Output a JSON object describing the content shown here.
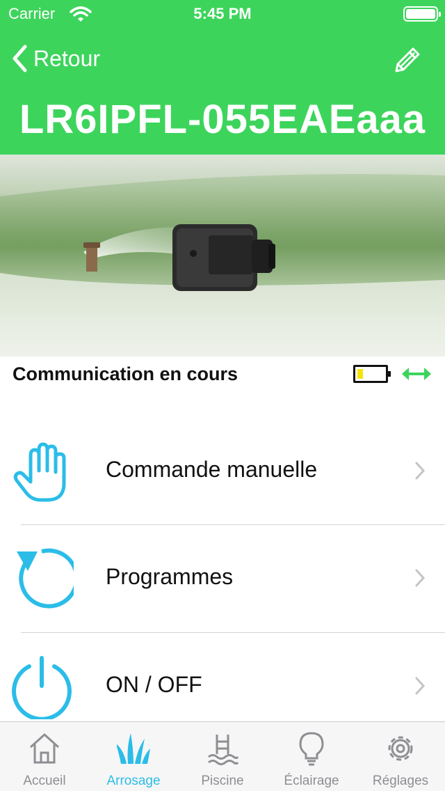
{
  "status_bar": {
    "carrier": "Carrier",
    "time": "5:45 PM"
  },
  "header": {
    "back_label": "Retour",
    "title": "LR6IPFL-055EAEaaa",
    "background_color": "#3dd45c",
    "edit_icon": "pencil-icon"
  },
  "status_row": {
    "text": "Communication en cours",
    "battery_level": 0.2,
    "link_icon": "double-arrow-icon",
    "link_color": "#3dd45c"
  },
  "menu": {
    "items": [
      {
        "label": "Commande manuelle",
        "icon": "hand-icon"
      },
      {
        "label": "Programmes",
        "icon": "refresh-icon"
      },
      {
        "label": "ON / OFF",
        "icon": "power-icon"
      }
    ],
    "accent_color": "#2bbde8"
  },
  "tab_bar": {
    "active_tab": "Arrosage",
    "tabs": [
      {
        "label": "Accueil",
        "icon": "home-icon"
      },
      {
        "label": "Arrosage",
        "icon": "grass-icon"
      },
      {
        "label": "Piscine",
        "icon": "pool-icon"
      },
      {
        "label": "Éclairage",
        "icon": "bulb-icon"
      },
      {
        "label": "Réglages",
        "icon": "gear-icon"
      }
    ]
  }
}
